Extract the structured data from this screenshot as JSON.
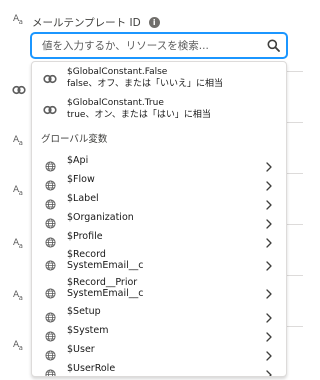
{
  "field": {
    "label": "メールテンプレート ID",
    "info_glyph": "i",
    "search_placeholder": "値を入力するか、リソースを検索..."
  },
  "constants": [
    {
      "name": "$GlobalConstant.False",
      "description": "false、オフ、または「いいえ」に相当"
    },
    {
      "name": "$GlobalConstant.True",
      "description": "true、オン、または「はい」に相当"
    }
  ],
  "group_header": "グローバル変数",
  "variables": [
    {
      "lines": [
        "$Api"
      ]
    },
    {
      "lines": [
        "$Flow"
      ]
    },
    {
      "lines": [
        "$Label"
      ]
    },
    {
      "lines": [
        "$Organization"
      ]
    },
    {
      "lines": [
        "$Profile"
      ]
    },
    {
      "lines": [
        "$Record",
        "SystemEmail__c"
      ]
    },
    {
      "lines": [
        "$Record__Prior",
        "SystemEmail__c"
      ]
    },
    {
      "lines": [
        "$Setup"
      ]
    },
    {
      "lines": [
        "$System"
      ]
    },
    {
      "lines": [
        "$User"
      ]
    },
    {
      "lines": [
        "$UserRole"
      ]
    }
  ],
  "background_icons": [
    "A",
    "a"
  ],
  "colors": {
    "focus": "#1b96ff",
    "border": "#dddbda",
    "icon": "#706e6b"
  },
  "icons": {
    "search": "search-icon",
    "constant": "link-icon",
    "variable": "globe-icon",
    "more": "chevron-right-icon"
  }
}
